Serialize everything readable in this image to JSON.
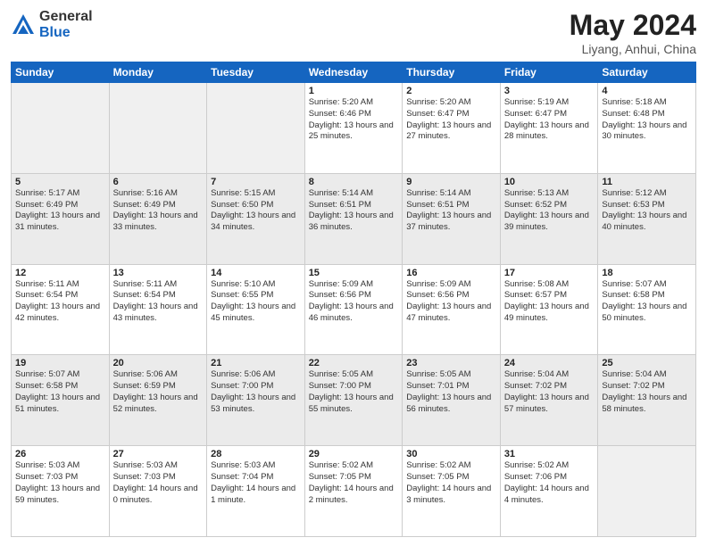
{
  "header": {
    "logo_general": "General",
    "logo_blue": "Blue",
    "month_title": "May 2024",
    "location": "Liyang, Anhui, China"
  },
  "weekdays": [
    "Sunday",
    "Monday",
    "Tuesday",
    "Wednesday",
    "Thursday",
    "Friday",
    "Saturday"
  ],
  "rows": [
    [
      {
        "day": "",
        "info": ""
      },
      {
        "day": "",
        "info": ""
      },
      {
        "day": "",
        "info": ""
      },
      {
        "day": "1",
        "info": "Sunrise: 5:20 AM\nSunset: 6:46 PM\nDaylight: 13 hours\nand 25 minutes."
      },
      {
        "day": "2",
        "info": "Sunrise: 5:20 AM\nSunset: 6:47 PM\nDaylight: 13 hours\nand 27 minutes."
      },
      {
        "day": "3",
        "info": "Sunrise: 5:19 AM\nSunset: 6:47 PM\nDaylight: 13 hours\nand 28 minutes."
      },
      {
        "day": "4",
        "info": "Sunrise: 5:18 AM\nSunset: 6:48 PM\nDaylight: 13 hours\nand 30 minutes."
      }
    ],
    [
      {
        "day": "5",
        "info": "Sunrise: 5:17 AM\nSunset: 6:49 PM\nDaylight: 13 hours\nand 31 minutes."
      },
      {
        "day": "6",
        "info": "Sunrise: 5:16 AM\nSunset: 6:49 PM\nDaylight: 13 hours\nand 33 minutes."
      },
      {
        "day": "7",
        "info": "Sunrise: 5:15 AM\nSunset: 6:50 PM\nDaylight: 13 hours\nand 34 minutes."
      },
      {
        "day": "8",
        "info": "Sunrise: 5:14 AM\nSunset: 6:51 PM\nDaylight: 13 hours\nand 36 minutes."
      },
      {
        "day": "9",
        "info": "Sunrise: 5:14 AM\nSunset: 6:51 PM\nDaylight: 13 hours\nand 37 minutes."
      },
      {
        "day": "10",
        "info": "Sunrise: 5:13 AM\nSunset: 6:52 PM\nDaylight: 13 hours\nand 39 minutes."
      },
      {
        "day": "11",
        "info": "Sunrise: 5:12 AM\nSunset: 6:53 PM\nDaylight: 13 hours\nand 40 minutes."
      }
    ],
    [
      {
        "day": "12",
        "info": "Sunrise: 5:11 AM\nSunset: 6:54 PM\nDaylight: 13 hours\nand 42 minutes."
      },
      {
        "day": "13",
        "info": "Sunrise: 5:11 AM\nSunset: 6:54 PM\nDaylight: 13 hours\nand 43 minutes."
      },
      {
        "day": "14",
        "info": "Sunrise: 5:10 AM\nSunset: 6:55 PM\nDaylight: 13 hours\nand 45 minutes."
      },
      {
        "day": "15",
        "info": "Sunrise: 5:09 AM\nSunset: 6:56 PM\nDaylight: 13 hours\nand 46 minutes."
      },
      {
        "day": "16",
        "info": "Sunrise: 5:09 AM\nSunset: 6:56 PM\nDaylight: 13 hours\nand 47 minutes."
      },
      {
        "day": "17",
        "info": "Sunrise: 5:08 AM\nSunset: 6:57 PM\nDaylight: 13 hours\nand 49 minutes."
      },
      {
        "day": "18",
        "info": "Sunrise: 5:07 AM\nSunset: 6:58 PM\nDaylight: 13 hours\nand 50 minutes."
      }
    ],
    [
      {
        "day": "19",
        "info": "Sunrise: 5:07 AM\nSunset: 6:58 PM\nDaylight: 13 hours\nand 51 minutes."
      },
      {
        "day": "20",
        "info": "Sunrise: 5:06 AM\nSunset: 6:59 PM\nDaylight: 13 hours\nand 52 minutes."
      },
      {
        "day": "21",
        "info": "Sunrise: 5:06 AM\nSunset: 7:00 PM\nDaylight: 13 hours\nand 53 minutes."
      },
      {
        "day": "22",
        "info": "Sunrise: 5:05 AM\nSunset: 7:00 PM\nDaylight: 13 hours\nand 55 minutes."
      },
      {
        "day": "23",
        "info": "Sunrise: 5:05 AM\nSunset: 7:01 PM\nDaylight: 13 hours\nand 56 minutes."
      },
      {
        "day": "24",
        "info": "Sunrise: 5:04 AM\nSunset: 7:02 PM\nDaylight: 13 hours\nand 57 minutes."
      },
      {
        "day": "25",
        "info": "Sunrise: 5:04 AM\nSunset: 7:02 PM\nDaylight: 13 hours\nand 58 minutes."
      }
    ],
    [
      {
        "day": "26",
        "info": "Sunrise: 5:03 AM\nSunset: 7:03 PM\nDaylight: 13 hours\nand 59 minutes."
      },
      {
        "day": "27",
        "info": "Sunrise: 5:03 AM\nSunset: 7:03 PM\nDaylight: 14 hours\nand 0 minutes."
      },
      {
        "day": "28",
        "info": "Sunrise: 5:03 AM\nSunset: 7:04 PM\nDaylight: 14 hours\nand 1 minute."
      },
      {
        "day": "29",
        "info": "Sunrise: 5:02 AM\nSunset: 7:05 PM\nDaylight: 14 hours\nand 2 minutes."
      },
      {
        "day": "30",
        "info": "Sunrise: 5:02 AM\nSunset: 7:05 PM\nDaylight: 14 hours\nand 3 minutes."
      },
      {
        "day": "31",
        "info": "Sunrise: 5:02 AM\nSunset: 7:06 PM\nDaylight: 14 hours\nand 4 minutes."
      },
      {
        "day": "",
        "info": ""
      }
    ]
  ]
}
